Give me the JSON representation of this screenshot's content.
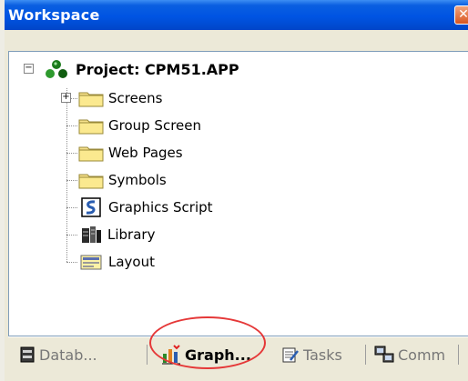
{
  "window": {
    "title": "Workspace",
    "close_symbol": "✕"
  },
  "tree": {
    "root": {
      "label": "Project: CPM51.APP",
      "expander": "−",
      "icon": "project-tree-icon"
    },
    "items": [
      {
        "label": "Screens",
        "icon": "folder-icon",
        "expander": "+"
      },
      {
        "label": "Group Screen",
        "icon": "folder-icon"
      },
      {
        "label": "Web Pages",
        "icon": "folder-icon"
      },
      {
        "label": "Symbols",
        "icon": "folder-icon"
      },
      {
        "label": "Graphics Script",
        "icon": "script-icon"
      },
      {
        "label": "Library",
        "icon": "library-icon"
      },
      {
        "label": "Layout",
        "icon": "layout-icon"
      }
    ]
  },
  "tabs": [
    {
      "label": "Datab...",
      "icon": "database-icon",
      "active": false
    },
    {
      "label": "Graph...",
      "icon": "graphics-icon",
      "active": true
    },
    {
      "label": "Tasks",
      "icon": "tasks-icon",
      "active": false
    },
    {
      "label": "Comm",
      "icon": "comm-icon",
      "active": false
    }
  ],
  "annotation": {
    "color": "#e53838",
    "target": "Graph..."
  },
  "colors": {
    "titlebar": "#0054e3",
    "folder": "#f5e08a",
    "panel": "#ece9d8"
  }
}
